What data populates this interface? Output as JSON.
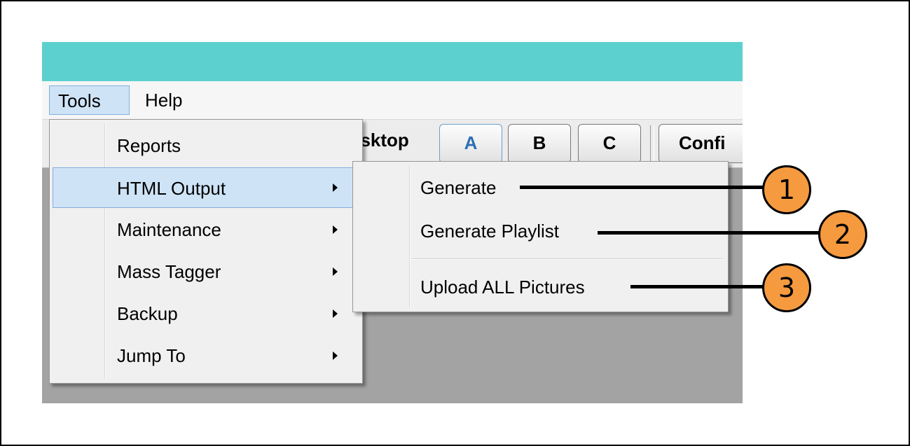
{
  "menubar": {
    "items": [
      {
        "label": "Tools"
      },
      {
        "label": "Help"
      }
    ]
  },
  "toolbar": {
    "desktop_label": "esktop",
    "tabs": [
      {
        "label": "A"
      },
      {
        "label": "B"
      },
      {
        "label": "C"
      }
    ],
    "config_label": "Confi"
  },
  "tools_menu": {
    "items": [
      {
        "label": "Reports",
        "has_submenu": false
      },
      {
        "label": "HTML Output",
        "has_submenu": true,
        "highlighted": true
      },
      {
        "label": "Maintenance",
        "has_submenu": true
      },
      {
        "label": "Mass Tagger",
        "has_submenu": true
      },
      {
        "label": "Backup",
        "has_submenu": true
      },
      {
        "label": "Jump To",
        "has_submenu": true
      }
    ]
  },
  "html_output_submenu": {
    "items": [
      {
        "label": "Generate"
      },
      {
        "label": "Generate Playlist"
      },
      {
        "label": "Upload ALL Pictures"
      }
    ]
  },
  "callouts": [
    {
      "number": "1"
    },
    {
      "number": "2"
    },
    {
      "number": "3"
    }
  ],
  "colors": {
    "titlebar": "#5cd0cf",
    "highlight": "#cfe3f6",
    "callout": "#f59a3f"
  }
}
